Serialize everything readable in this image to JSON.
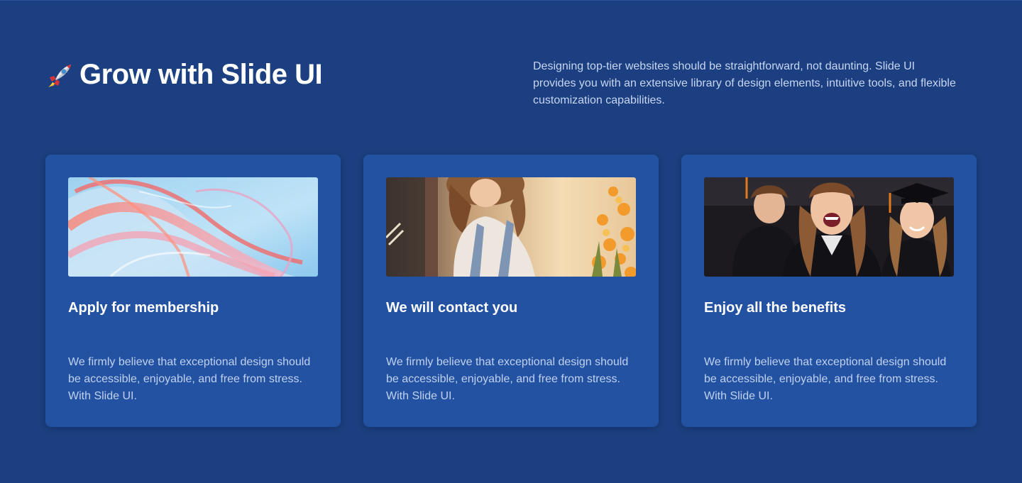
{
  "header": {
    "title": "Grow with Slide UI",
    "rocket_icon": "rocket-icon",
    "intro": "Designing top-tier websites should be straightforward, not daunting. Slide UI provides you with an extensive library of design elements, intuitive tools, and flexible customization capabilities."
  },
  "cards": [
    {
      "title": "Apply for membership",
      "text": "We firmly believe that exceptional design should be accessible, enjoyable, and free from stress. With Slide UI."
    },
    {
      "title": "We will contact you",
      "text": "We firmly believe that exceptional design should be accessible, enjoyable, and free from stress. With Slide UI."
    },
    {
      "title": "Enjoy all the benefits",
      "text": "We firmly believe that exceptional design should be accessible, enjoyable, and free from stress. With Slide UI."
    }
  ],
  "colors": {
    "background": "#1b3f80",
    "card": "#2352a3",
    "heading": "#ffffff",
    "body_text": "#c0d1ef"
  }
}
